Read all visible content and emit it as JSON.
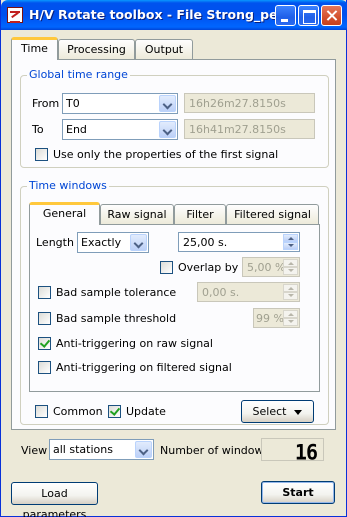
{
  "window": {
    "title": "H/V Rotate toolbox - File Strong_peak"
  },
  "main_tabs": [
    {
      "label": "Time",
      "active": true
    },
    {
      "label": "Processing",
      "active": false
    },
    {
      "label": "Output",
      "active": false
    }
  ],
  "global_time_range": {
    "title": "Global time range",
    "from_label": "From",
    "from_value": "T0",
    "from_time": "16h26m27.8150s",
    "to_label": "To",
    "to_value": "End",
    "to_time": "16h41m27.8150s",
    "first_signal_label": "Use only the properties of the first signal",
    "first_signal_checked": false
  },
  "time_windows": {
    "title": "Time windows",
    "tabs": [
      {
        "label": "General",
        "active": true
      },
      {
        "label": "Raw signal",
        "active": false
      },
      {
        "label": "Filter",
        "active": false
      },
      {
        "label": "Filtered signal",
        "active": false
      }
    ],
    "length_label": "Length",
    "length_mode": "Exactly",
    "length_value": "25,00 s.",
    "overlap_label": "Overlap by",
    "overlap_checked": false,
    "overlap_value": "5,00 %",
    "bad_tolerance_label": "Bad sample tolerance",
    "bad_tolerance_checked": false,
    "bad_tolerance_value": "0,00 s.",
    "bad_threshold_label": "Bad sample threshold",
    "bad_threshold_checked": false,
    "bad_threshold_value": "99 %",
    "anti_raw_label": "Anti-triggering on raw signal",
    "anti_raw_checked": true,
    "anti_filtered_label": "Anti-triggering on filtered signal",
    "anti_filtered_checked": false,
    "common_label": "Common",
    "common_checked": false,
    "update_label": "Update",
    "update_checked": true,
    "select_label": "Select"
  },
  "footer": {
    "view_label": "View",
    "view_value": "all stations",
    "windows_label": "Number of windows",
    "windows_count": "16",
    "load_label": "Load parameters",
    "start_label": "Start"
  },
  "colors": {
    "titlebar": "#0053ee",
    "group_title": "#0046d5",
    "active_tab_accent": "#ffc83c",
    "window_bg": "#ece9d8"
  },
  "icons": {
    "app": "app-icon",
    "minimize": "minimize-icon",
    "maximize": "maximize-icon",
    "close": "close-icon"
  }
}
